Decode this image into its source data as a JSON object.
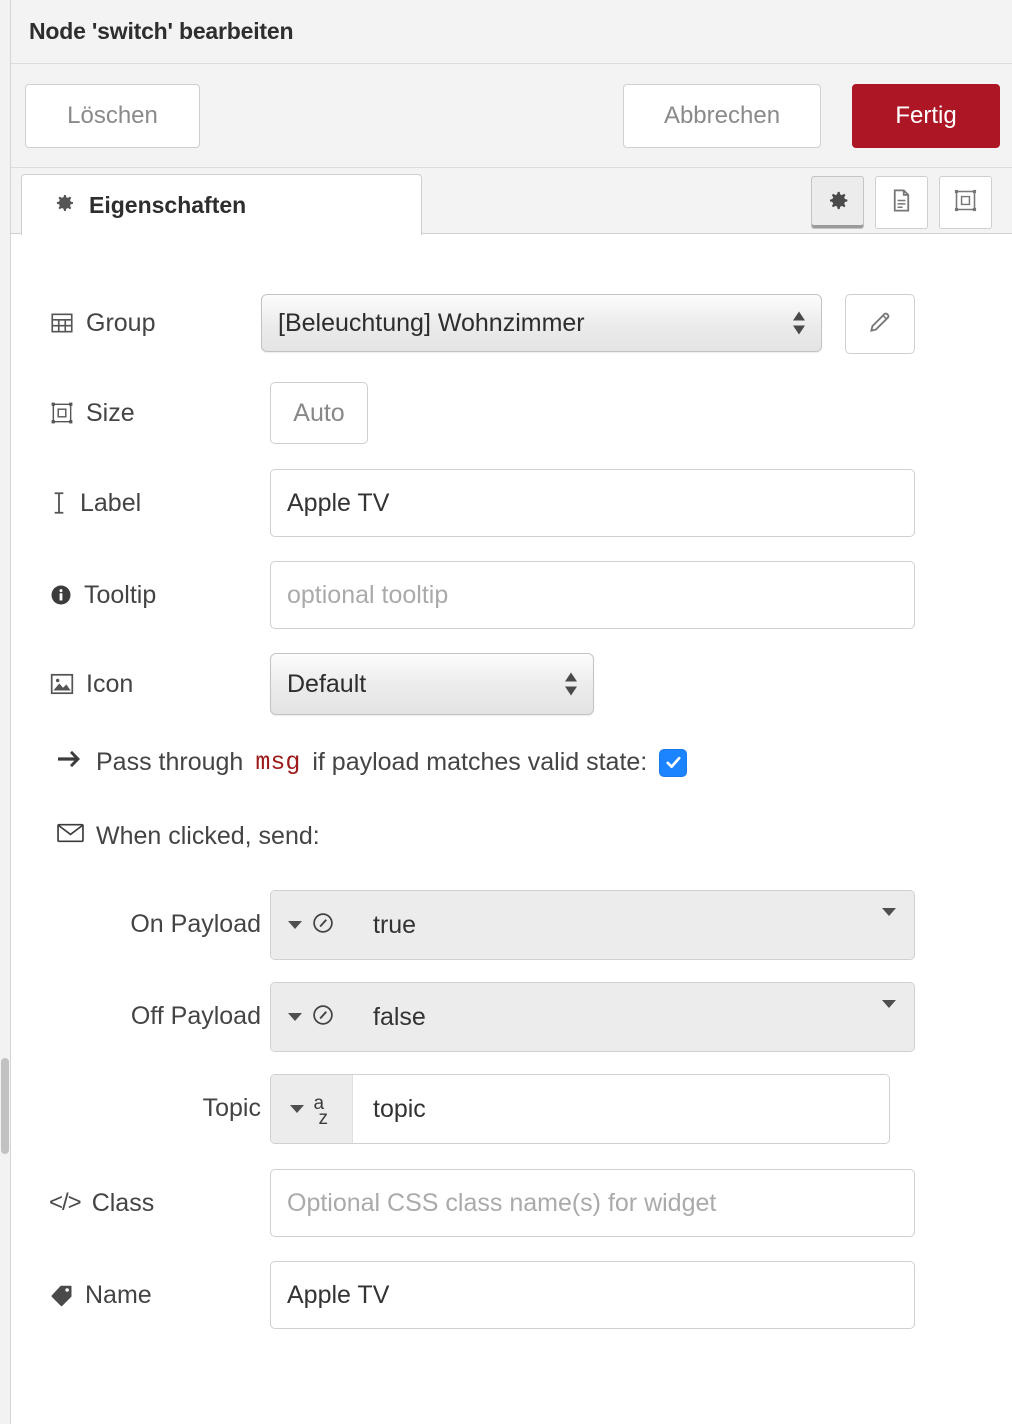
{
  "header": {
    "title": "Node 'switch' bearbeiten"
  },
  "toolbar": {
    "delete_label": "Löschen",
    "cancel_label": "Abbrechen",
    "done_label": "Fertig"
  },
  "tabs": {
    "active_label": "Eigenschaften",
    "icon_buttons": [
      {
        "name": "properties-tab-icon",
        "selected": true
      },
      {
        "name": "description-tab-icon",
        "selected": false
      },
      {
        "name": "appearance-tab-icon",
        "selected": false
      }
    ]
  },
  "form": {
    "group": {
      "label": "Group",
      "value": "[Beleuchtung] Wohnzimmer",
      "edit_button_title": "edit"
    },
    "size": {
      "label": "Size",
      "value": "Auto"
    },
    "label_field": {
      "label": "Label",
      "value": "Apple TV",
      "placeholder": ""
    },
    "tooltip": {
      "label": "Tooltip",
      "value": "",
      "placeholder": "optional tooltip"
    },
    "icon": {
      "label": "Icon",
      "value": "Default"
    },
    "passthrough": {
      "text_before": "Pass through",
      "msg_token": "msg",
      "text_after": "if payload matches valid state:",
      "checked": true
    },
    "when_clicked": {
      "label": "When clicked, send:"
    },
    "on_payload": {
      "label": "On Payload",
      "type": "bool",
      "value": "true"
    },
    "off_payload": {
      "label": "Off Payload",
      "type": "bool",
      "value": "false"
    },
    "topic": {
      "label": "Topic",
      "type": "str",
      "type_glyph_top": "a",
      "type_glyph_bottom": "z",
      "value": "topic",
      "placeholder": "topic"
    },
    "css_class": {
      "label": "Class",
      "value": "",
      "placeholder": "Optional CSS class name(s) for widget"
    },
    "name": {
      "label": "Name",
      "value": "Apple TV",
      "placeholder": ""
    }
  },
  "colors": {
    "done_button": "#ad1625",
    "checkbox": "#1c84ff",
    "msg_token": "#9c1a1a",
    "header_bg": "#f3f3f3"
  }
}
